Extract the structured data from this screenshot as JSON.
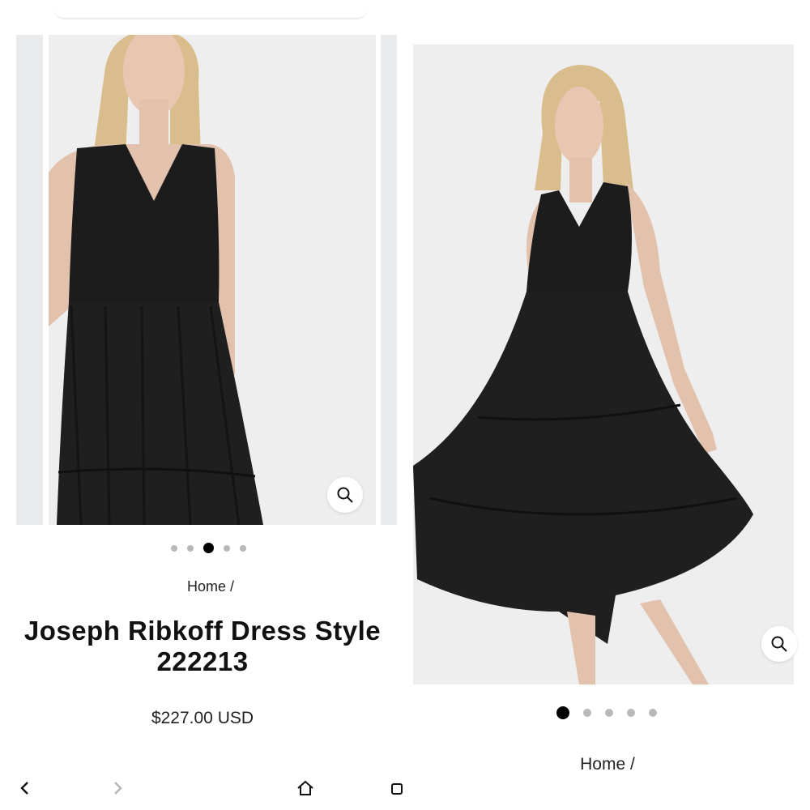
{
  "left": {
    "breadcrumb": {
      "home_label": "Home",
      "separator": "/"
    },
    "product": {
      "title_line1": "Joseph Ribkoff Dress Style",
      "title_line2": "222213",
      "price": "$227.00 USD"
    },
    "carousel": {
      "count": 5,
      "active_index": 2
    },
    "nav_icons": [
      "back-arrow-icon",
      "forward-arrow-icon",
      "home-icon",
      "tabs-icon"
    ]
  },
  "right": {
    "breadcrumb": {
      "home_label": "Home",
      "separator": "/"
    },
    "carousel": {
      "count": 5,
      "active_index": 0
    }
  },
  "colors": {
    "dress": "#1c1c1c",
    "background": "#eeeeee",
    "skin": "#e3c2ad",
    "hair": "#d9bd8c",
    "dot_inactive": "#b8b8b8",
    "dot_active": "#000000"
  }
}
